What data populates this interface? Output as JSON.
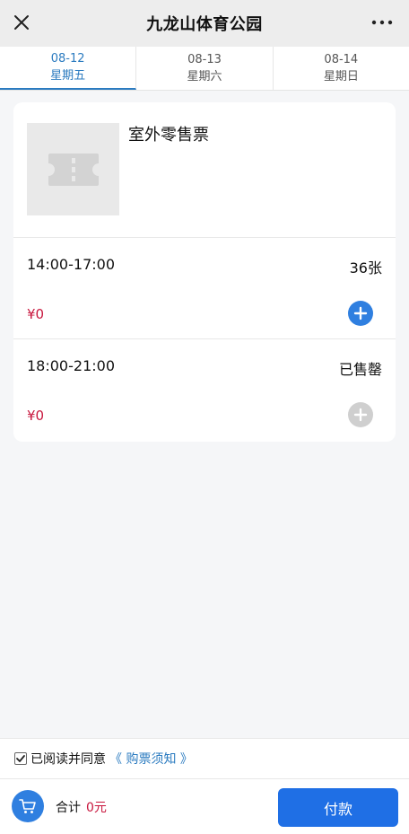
{
  "header": {
    "title": "九龙山体育公园",
    "close_icon": "close-icon",
    "more_icon": "more-icon"
  },
  "tabs": [
    {
      "date": "08-12",
      "weekday": "星期五",
      "active": true
    },
    {
      "date": "08-13",
      "weekday": "星期六",
      "active": false
    },
    {
      "date": "08-14",
      "weekday": "星期日",
      "active": false
    }
  ],
  "product": {
    "name": "室外零售票",
    "image_icon": "ticket-icon"
  },
  "sessions": [
    {
      "time": "14:00-17:00",
      "stock": "36张",
      "price": "¥0",
      "add_enabled": true
    },
    {
      "time": "18:00-21:00",
      "stock": "已售罄",
      "price": "¥0",
      "add_enabled": false
    }
  ],
  "agreement": {
    "checked": true,
    "text": "已阅读并同意",
    "link": "《 购票须知 》"
  },
  "footer": {
    "total_label": "合计",
    "total_amount": "0元",
    "pay_label": "付款",
    "cart_icon": "cart-icon"
  },
  "colors": {
    "accent": "#2b7bc0",
    "button": "#1f6fe5",
    "price": "#c8163d"
  }
}
